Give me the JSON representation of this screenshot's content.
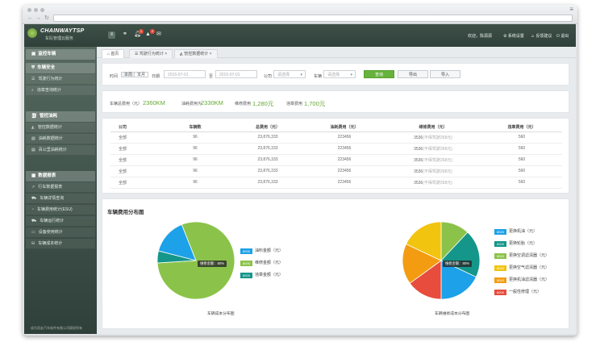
{
  "app": {
    "brand": "CHAINWAYTSP",
    "brand_sub": "车队管理云服务",
    "badges": {
      "messages": "1",
      "alerts": "2"
    },
    "user": {
      "welcome": "欢迎，陈源源",
      "settings": "系统设置",
      "feedback": "反馈建议",
      "logout": "退出"
    }
  },
  "sidebar": {
    "sections": [
      {
        "label": "监控车辆",
        "icon": "car-icon",
        "items": []
      },
      {
        "label": "车辆安全",
        "icon": "shield-icon",
        "items": [
          {
            "label": "驾驶行为统计",
            "icon": "list-icon"
          },
          {
            "label": "违章查询统计",
            "icon": "search-icon"
          }
        ]
      },
      {
        "label": "管控油耗",
        "icon": "fuel-icon",
        "items": [
          {
            "label": "管控数据统计",
            "icon": "road-icon"
          },
          {
            "label": "油耗数据统计",
            "icon": "doc-icon"
          },
          {
            "label": "百公里油耗统计",
            "icon": "doc-icon"
          }
        ]
      },
      {
        "label": "数据报表",
        "icon": "report-icon",
        "items": [
          {
            "label": "行车数据报表",
            "icon": "trend-icon"
          },
          {
            "label": "车辆详情查询",
            "icon": "car-icon"
          },
          {
            "label": "车辆费用统计(ESU)",
            "icon": "pie-icon"
          },
          {
            "label": "车辆运行统计",
            "icon": "car-icon"
          },
          {
            "label": "设备使用统计",
            "icon": "device-icon"
          },
          {
            "label": "车辆成本统计",
            "icon": "cost-icon"
          }
        ]
      }
    ],
    "copyright": "成为用友汽车软件有限公司版权所有"
  },
  "tabs": [
    {
      "label": "首页",
      "icon": "home-icon"
    },
    {
      "label": "驾驶行为统计",
      "icon": "list-icon"
    },
    {
      "label": "管控数据统计",
      "icon": "road-icon"
    }
  ],
  "filters": {
    "time_label": "时间",
    "period_options": [
      "本周",
      "本月"
    ],
    "date_label": "日期",
    "date_from": "2015-07-01",
    "to_label": "至",
    "date_to": "2015-07-01",
    "company_label": "公司",
    "company_placeholder": "请选择",
    "vehicle_label": "车辆",
    "vehicle_placeholder": "请选择",
    "query_button": "查询",
    "export_button": "导出",
    "import_button": "导入"
  },
  "stats": [
    {
      "label": "车辆总费用（元）",
      "value": "2360KM"
    },
    {
      "label": "油耗费用为",
      "value": "2330KM"
    },
    {
      "label": "维修费用",
      "value": "1,280元"
    },
    {
      "label": "违章费用",
      "value": "1,700元"
    }
  ],
  "table": {
    "headers": [
      "公司",
      "车辆数",
      "总费用（元）",
      "油耗费用（元）",
      "维修费用（元）",
      "违章费用（元）"
    ],
    "rows": [
      {
        "company": "全部",
        "count": "96",
        "total": "23,876,333",
        "fuel": "223456",
        "repair": "3536",
        "repair_note": "(不保驾驶268元)",
        "fine": "560"
      },
      {
        "company": "全部",
        "count": "96",
        "total": "23,876,333",
        "fuel": "223456",
        "repair": "3536",
        "repair_note": "(不保驾驶268元)",
        "fine": "560"
      },
      {
        "company": "全部",
        "count": "96",
        "total": "23,876,333",
        "fuel": "223456",
        "repair": "3536",
        "repair_note": "(不保驾驶268元)",
        "fine": "560"
      },
      {
        "company": "全部",
        "count": "96",
        "total": "23,876,333",
        "fuel": "223456",
        "repair": "3536",
        "repair_note": "(不保驾驶268元)",
        "fine": "560"
      },
      {
        "company": "全部",
        "count": "96",
        "total": "23,876,333",
        "fuel": "223456",
        "repair": "3536",
        "repair_note": "(不保驾驶268元)",
        "fine": "560"
      }
    ]
  },
  "charts_panel": {
    "title": "车辆费用分布图"
  },
  "chart_data": [
    {
      "type": "pie",
      "title": "车辆成本分布图",
      "tooltip": "维修金额：80%",
      "slices": [
        {
          "label": "油料金额（元）",
          "value": 15,
          "color": "#1da1e8"
        },
        {
          "label": "维修金额（元）",
          "value": 80,
          "color": "#8bc34a"
        },
        {
          "label": "违章金额（元）",
          "value": 5,
          "color": "#15968a"
        }
      ],
      "legend_badges": [
        "8000",
        "8000",
        "8000"
      ]
    },
    {
      "type": "pie",
      "title": "车辆维修成本分布图",
      "tooltip": "维修金额：80%",
      "slices": [
        {
          "label": "更换机油（元）",
          "value": 12,
          "color": "#8bc34a"
        },
        {
          "label": "更换轮胎（元）",
          "value": 20,
          "color": "#15968a"
        },
        {
          "label": "更换空调滤清器（元）",
          "value": 18,
          "color": "#1da1e8"
        },
        {
          "label": "更换空气滤清器（元）",
          "value": 15,
          "color": "#e74c3c"
        },
        {
          "label": "更换机油滤清器（元）",
          "value": 17,
          "color": "#f39c12"
        },
        {
          "label": "一般性修理（元）",
          "value": 18,
          "color": "#f1c40f"
        }
      ],
      "legend_badges": [
        "8000",
        "8000",
        "8000",
        "8000",
        "8000",
        "8000"
      ],
      "legend_colors": [
        "#1da1e8",
        "#15968a",
        "#8bc34a",
        "#f1c40f",
        "#f39c12",
        "#e74c3c"
      ]
    }
  ]
}
